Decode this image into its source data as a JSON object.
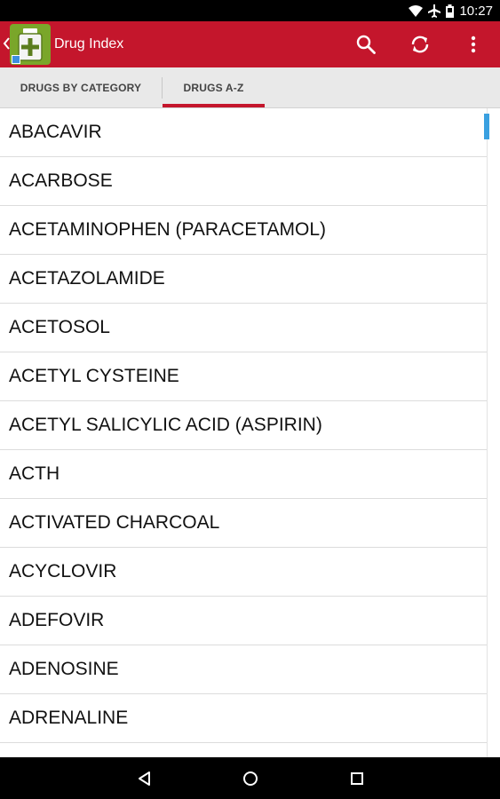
{
  "status_bar": {
    "time": "10:27",
    "icons": [
      "wifi-icon",
      "airplane-mode-icon",
      "battery-icon"
    ]
  },
  "app_bar": {
    "title": "Drug Index",
    "color": "#c4162c",
    "actions": [
      "search-icon",
      "refresh-icon",
      "overflow-menu-icon"
    ]
  },
  "tabs": [
    {
      "label": "DRUGS BY CATEGORY",
      "selected": false
    },
    {
      "label": "DRUGS A-Z",
      "selected": true
    }
  ],
  "drugs": [
    "ABACAVIR",
    "ACARBOSE",
    "ACETAMINOPHEN (PARACETAMOL)",
    "ACETAZOLAMIDE",
    "ACETOSOL",
    "ACETYL CYSTEINE",
    "ACETYL SALICYLIC ACID (ASPIRIN)",
    "ACTH",
    "ACTIVATED CHARCOAL",
    "ACYCLOVIR",
    "ADEFOVIR",
    "ADENOSINE",
    "ADRENALINE"
  ],
  "nav_bar": [
    "back-nav-icon",
    "home-nav-icon",
    "recents-nav-icon"
  ]
}
